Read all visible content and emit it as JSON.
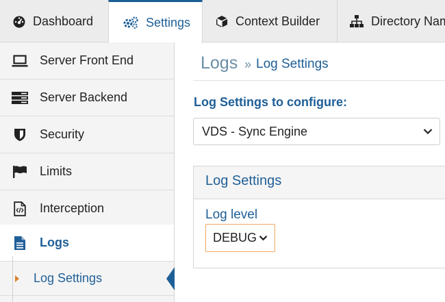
{
  "tabs": [
    {
      "label": "Dashboard",
      "icon": "dashboard-icon"
    },
    {
      "label": "Settings",
      "icon": "gears-icon",
      "active": true
    },
    {
      "label": "Context Builder",
      "icon": "cube-icon"
    },
    {
      "label": "Directory Nam",
      "icon": "sitemap-icon"
    }
  ],
  "sidebar": {
    "items": [
      {
        "label": "Server Front End",
        "icon": "laptop-icon"
      },
      {
        "label": "Server Backend",
        "icon": "server-icon"
      },
      {
        "label": "Security",
        "icon": "shield-icon"
      },
      {
        "label": "Limits",
        "icon": "flag-icon"
      },
      {
        "label": "Interception",
        "icon": "code-file-icon"
      },
      {
        "label": "Logs",
        "icon": "document-icon",
        "active": true
      }
    ],
    "sub_item": {
      "label": "Log Settings"
    }
  },
  "breadcrumb": {
    "root": "Logs",
    "separator": "»",
    "leaf": "Log Settings"
  },
  "config": {
    "label": "Log Settings to configure:",
    "selected": "VDS - Sync Engine"
  },
  "panel": {
    "title": "Log Settings",
    "level_label": "Log level",
    "level_value": "DEBUG"
  },
  "colors": {
    "accent": "#1f5f97",
    "focus_border": "#f0a860"
  }
}
